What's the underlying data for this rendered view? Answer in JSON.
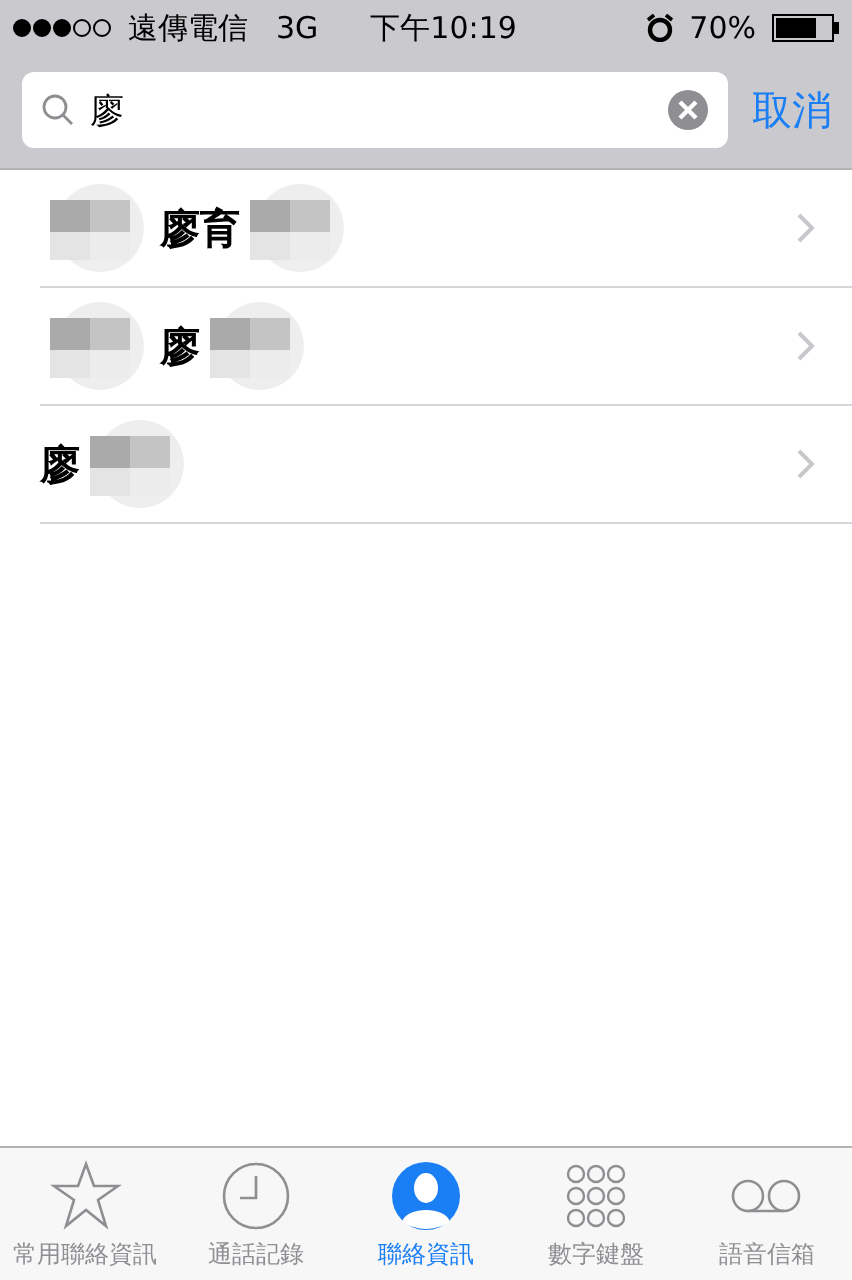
{
  "status_bar": {
    "carrier": "遠傳電信",
    "network": "3G",
    "time": "下午10:19",
    "battery": "70%"
  },
  "search": {
    "value": "廖",
    "cancel": "取消"
  },
  "results": [
    {
      "parts": [
        {
          "kind": "mosaic"
        },
        {
          "kind": "text",
          "text": "廖育"
        },
        {
          "kind": "mosaic"
        }
      ]
    },
    {
      "parts": [
        {
          "kind": "mosaic"
        },
        {
          "kind": "text",
          "text": "廖"
        },
        {
          "kind": "mosaic"
        }
      ]
    },
    {
      "parts": [
        {
          "kind": "text",
          "text": "廖"
        },
        {
          "kind": "mosaic"
        }
      ]
    }
  ],
  "tab_bar": [
    {
      "label": "常用聯絡資訊",
      "kind": "star",
      "selected": false
    },
    {
      "label": "通話記錄",
      "kind": "clock",
      "selected": false
    },
    {
      "label": "聯絡資訊",
      "kind": "person",
      "selected": true
    },
    {
      "label": "數字鍵盤",
      "kind": "keypad",
      "selected": false
    },
    {
      "label": "語音信箱",
      "kind": "voicemail",
      "selected": false
    }
  ]
}
